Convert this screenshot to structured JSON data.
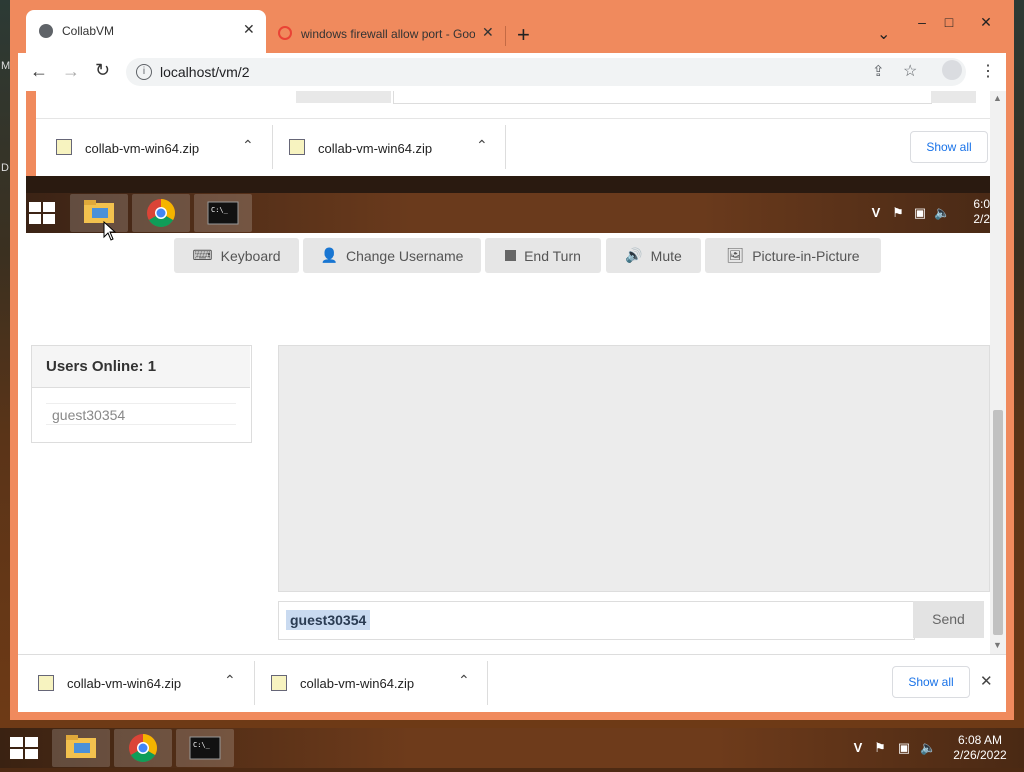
{
  "browser": {
    "tabs": [
      {
        "title": "CollabVM",
        "active": true
      },
      {
        "title": "windows firewall allow port - Goo",
        "active": false
      }
    ],
    "url": "localhost/vm/2",
    "controls": {
      "minimize": "–",
      "maximize": "□",
      "close": "✕",
      "new_tab": "+",
      "tab_list": "⌄"
    }
  },
  "desktop": {
    "edge_letters": [
      "M",
      "D"
    ]
  },
  "vm": {
    "inner_downloads": [
      {
        "name": "collab-vm-win64.zip"
      },
      {
        "name": "collab-vm-win64.zip"
      }
    ],
    "inner_show_all": "Show all",
    "inner_clock": {
      "time": "6:0",
      "date": "2/2"
    },
    "buttons": [
      {
        "label": "Keyboard",
        "icon": "keyboard-icon"
      },
      {
        "label": "Change Username",
        "icon": "user-icon"
      },
      {
        "label": "End Turn",
        "icon": "stop-icon"
      },
      {
        "label": "Mute",
        "icon": "speaker-icon"
      },
      {
        "label": "Picture-in-Picture",
        "icon": "picture-icon"
      }
    ],
    "users_online_label": "Users Online: 1",
    "users": [
      "guest30354"
    ],
    "chat": {
      "username": "guest30354",
      "send_label": "Send"
    }
  },
  "downloads": [
    {
      "name": "collab-vm-win64.zip"
    },
    {
      "name": "collab-vm-win64.zip"
    }
  ],
  "show_all": "Show all",
  "taskbar": {
    "time": "6:08 AM",
    "date": "2/26/2022"
  },
  "colors": {
    "window_frame": "#f08a5d",
    "accent_link": "#1a73e8",
    "chat_name_highlight": "#c9daf0"
  }
}
